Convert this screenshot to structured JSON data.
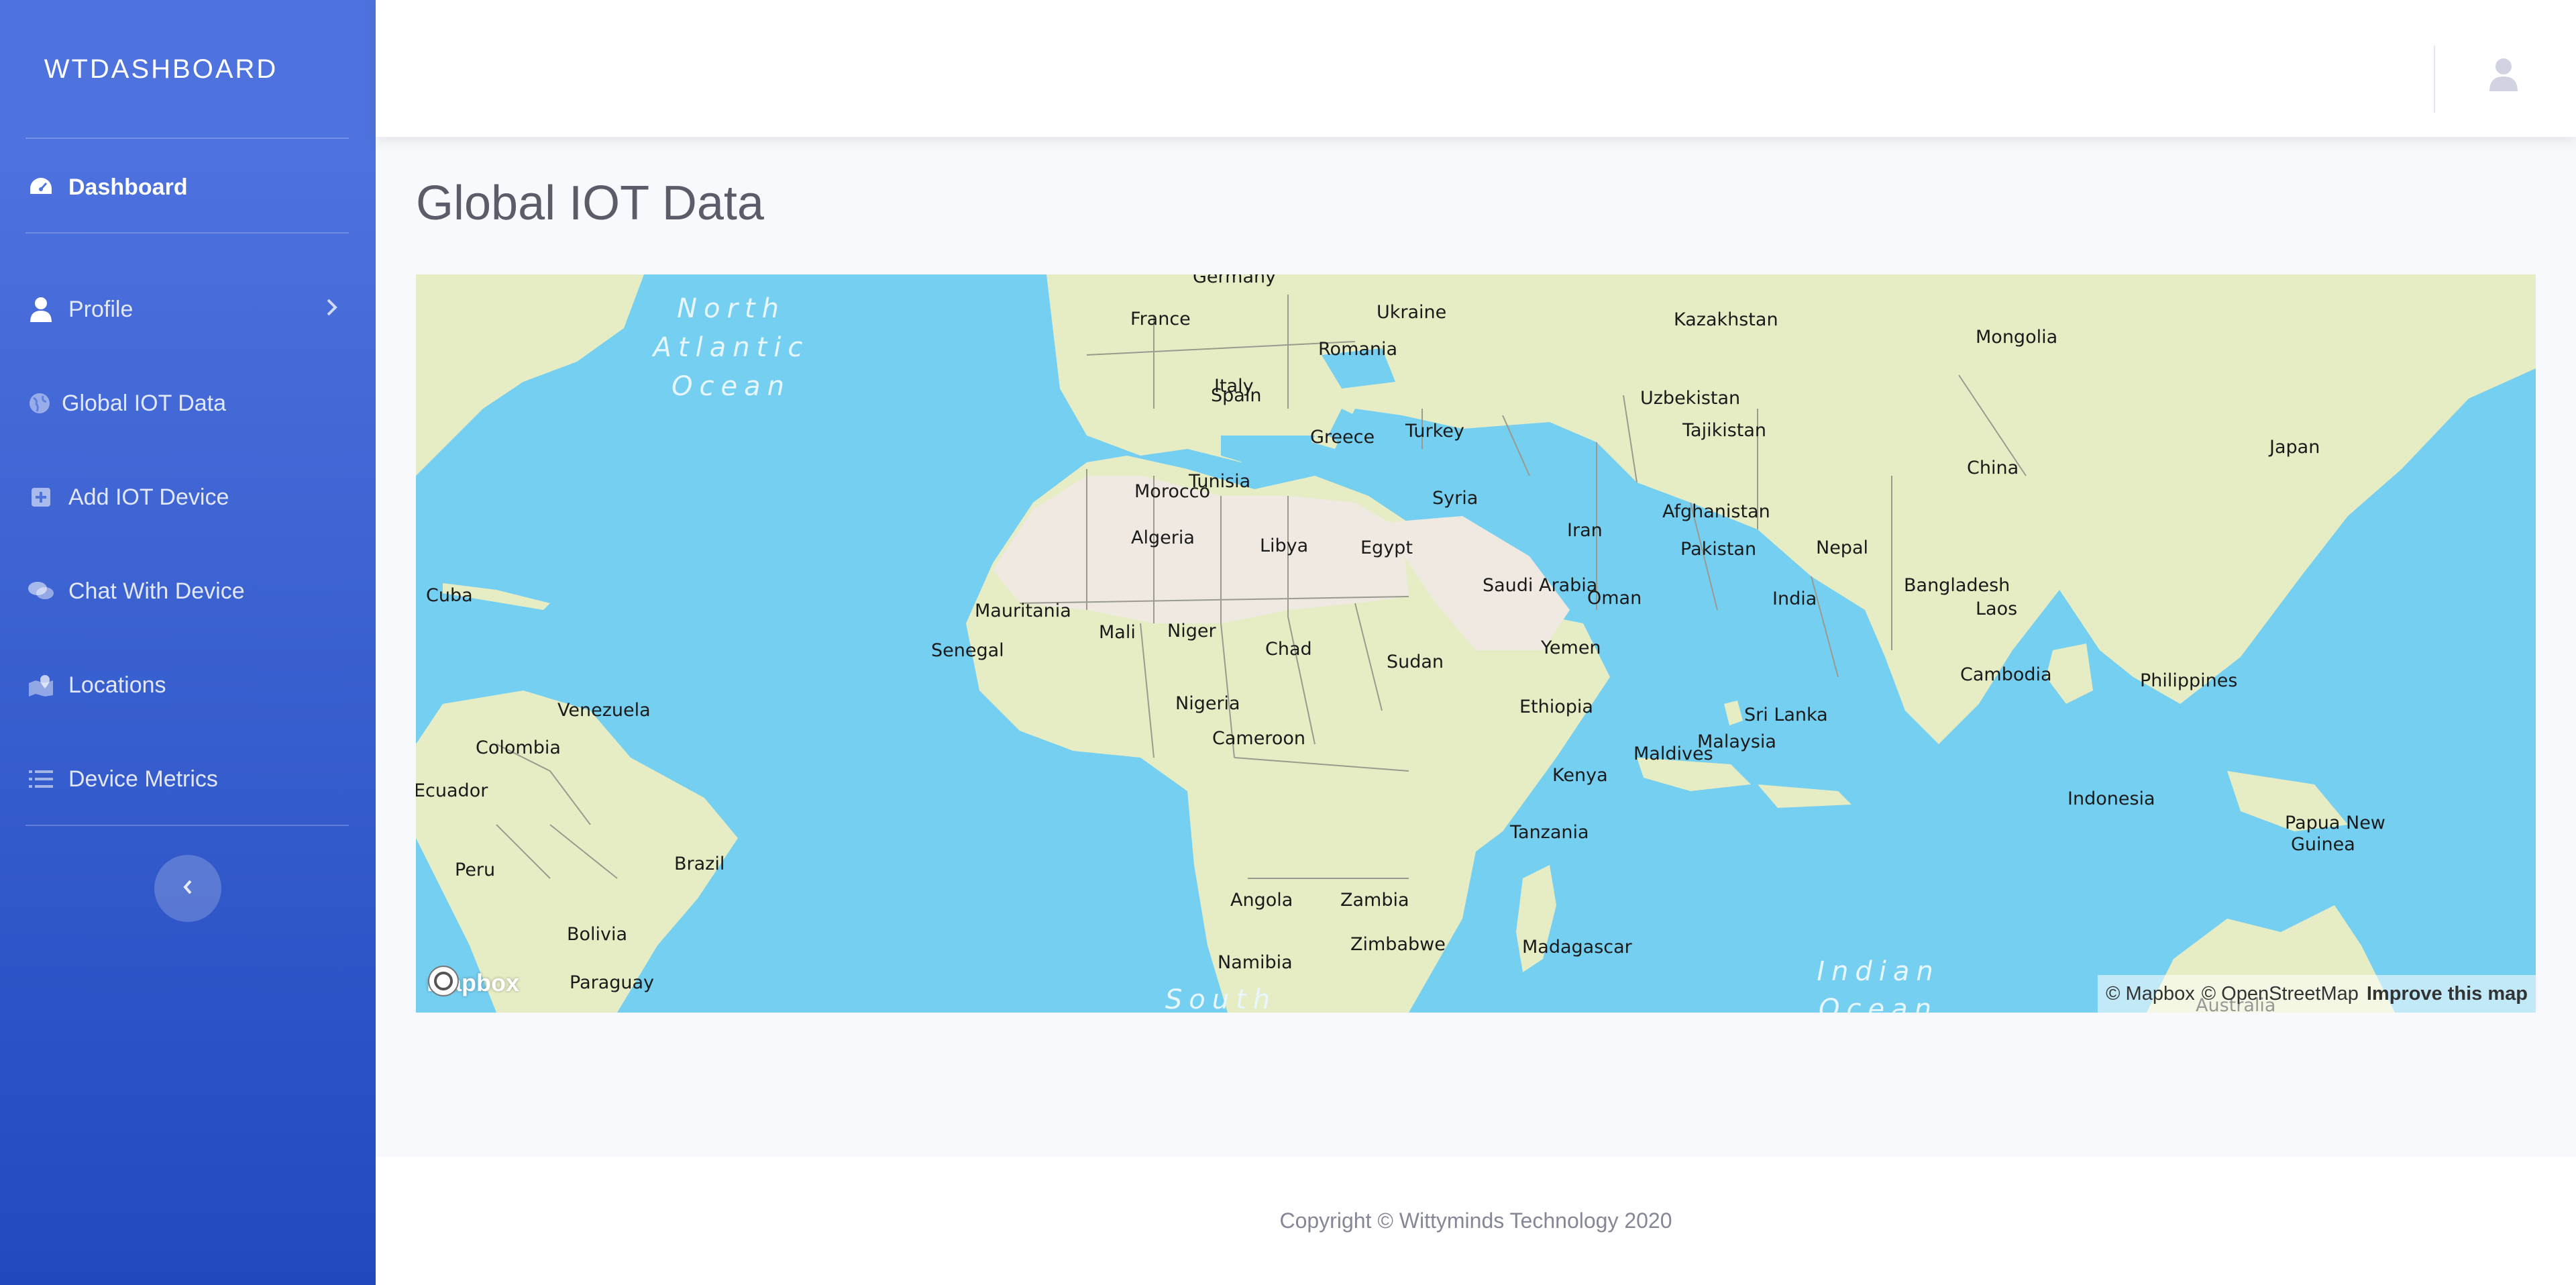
{
  "sidebar": {
    "brand": "WTDASHBOARD",
    "items": [
      {
        "label": "Dashboard",
        "icon": "tachometer-icon"
      },
      {
        "label": "Profile",
        "icon": "user-icon"
      },
      {
        "label": "Global IOT Data",
        "icon": "globe-icon"
      },
      {
        "label": "Add IOT Device",
        "icon": "plus-square-icon"
      },
      {
        "label": "Chat With Device",
        "icon": "comments-icon"
      },
      {
        "label": "Locations",
        "icon": "map-marked-icon"
      },
      {
        "label": "Device Metrics",
        "icon": "list-icon"
      }
    ],
    "active_item": "Dashboard"
  },
  "topbar": {
    "user_icon": "user-icon"
  },
  "main": {
    "title": "Global IOT Data"
  },
  "map": {
    "provider_logo": "mapbox",
    "attribution": {
      "mapbox": "© Mapbox",
      "osm": "© OpenStreetMap",
      "improve": "Improve this map"
    },
    "oceans": [
      {
        "lines": [
          "North",
          "Atlantic",
          "Ocean"
        ]
      },
      {
        "lines": [
          "Indian",
          "Ocean"
        ]
      },
      {
        "lines": [
          "South"
        ]
      }
    ],
    "labels": [
      "Germany",
      "France",
      "Ukraine",
      "Romania",
      "Kazakhstan",
      "Mongolia",
      "Spain",
      "Italy",
      "Uzbekistan",
      "Tajikistan",
      "Greece",
      "Turkey",
      "Japan",
      "China",
      "Tunisia",
      "Syria",
      "Afghanistan",
      "Morocco",
      "Iran",
      "Algeria",
      "Libya",
      "Egypt",
      "Pakistan",
      "Nepal",
      "Bangladesh",
      "Saudi Arabia",
      "India",
      "Oman",
      "Cuba",
      "Mauritania",
      "Laos",
      "Mali",
      "Niger",
      "Senegal",
      "Chad",
      "Yemen",
      "Sudan",
      "Cambodia",
      "Philippines",
      "Venezuela",
      "Nigeria",
      "Ethiopia",
      "Sri Lanka",
      "Colombia",
      "Cameroon",
      "Malaysia",
      "Maldives",
      "Kenya",
      "Ecuador",
      "Indonesia",
      "Tanzania",
      "Papua New",
      "Guinea",
      "Brazil",
      "Peru",
      "Angola",
      "Zambia",
      "Bolivia",
      "Zimbabwe",
      "Madagascar",
      "Namibia",
      "Paraguay",
      "Australia"
    ]
  },
  "footer": {
    "copyright": "Copyright © Wittyminds Technology 2020"
  },
  "colors": {
    "sidebar_top": "#4e73df",
    "sidebar_bottom": "#224abe",
    "ocean": "#75cff0",
    "land": "#e6edc4",
    "desert": "#efe9e1"
  }
}
